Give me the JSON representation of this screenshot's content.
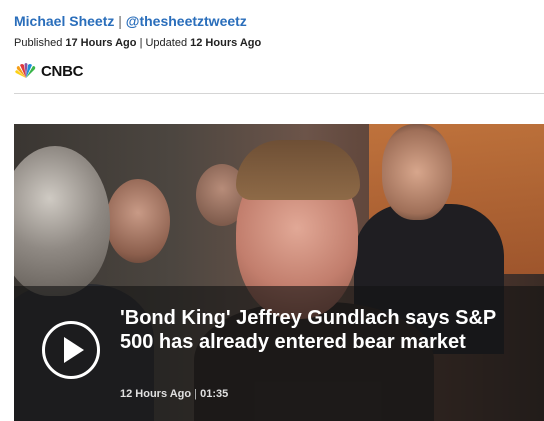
{
  "byline": {
    "author": "Michael Sheetz",
    "separator": "|",
    "handle": "@thesheetztweetz"
  },
  "timestamps": {
    "published_label": "Published",
    "published_value": "17 Hours Ago",
    "separator": "|",
    "updated_label": "Updated",
    "updated_value": "12 Hours Ago"
  },
  "logo": {
    "text": "CNBC",
    "icon": "peacock-icon"
  },
  "video": {
    "title": "'Bond King' Jeffrey Gundlach says S&P 500 has already entered bear market",
    "age": "12 Hours Ago",
    "separator": "|",
    "duration": "01:35",
    "play_icon": "play-icon"
  },
  "colors": {
    "link": "#2a6ebb",
    "text": "#222222",
    "divider": "#d5d5d5",
    "overlay": "rgba(20,20,20,0.62)"
  }
}
